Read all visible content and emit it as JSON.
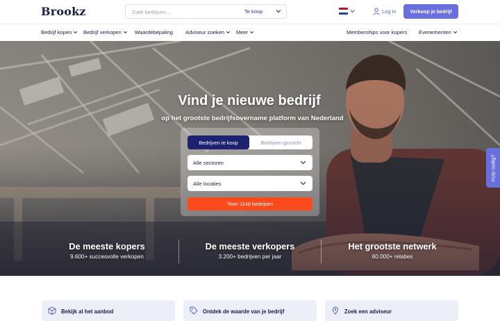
{
  "header": {
    "logo": "Brookz",
    "search_placeholder": "Zoek bedrijven...",
    "search_type": "Te koop",
    "login_label": "Log in",
    "sell_button": "Verkoop je bedrijf",
    "language_flag": "nl-flag-icon"
  },
  "nav": {
    "items": [
      {
        "label": "Bedrijf kopen",
        "dropdown": true
      },
      {
        "label": "Bedrijf verkopen",
        "dropdown": true
      },
      {
        "label": "Waardebepaling",
        "dropdown": false
      },
      {
        "label": "Adviseur zoeken",
        "dropdown": true
      },
      {
        "label": "Meer",
        "dropdown": true
      },
      {
        "label": "Memberships voor kopers",
        "dropdown": false
      },
      {
        "label": "Evenementen",
        "dropdown": true
      }
    ]
  },
  "hero": {
    "title": "Vind je nieuwe bedrijf",
    "subtitle": "op het grootste bedrijfsovername platform van Nederland",
    "tab_active": "Bedrijven te koop",
    "tab_inactive": "Bedrijven gezocht",
    "sector_select": "Alle sectoren",
    "location_select": "Alle locaties",
    "cta": "Toon 1148 bedrijven"
  },
  "stats": [
    {
      "title": "De meeste kopers",
      "sub": "9.600+ succesvolle verkopen"
    },
    {
      "title": "De meeste verkopers",
      "sub": "3.200+ bedrijven per jaar"
    },
    {
      "title": "Het grootste netwerk",
      "sub": "60.000+ relaties"
    }
  ],
  "help_tab": "Hulp nodig?",
  "cards": [
    {
      "label": "Bekijk al het aanbod",
      "icon": "box-icon"
    },
    {
      "label": "Ontdek de waarde van je bedrijf",
      "icon": "tag-icon"
    },
    {
      "label": "Zoek een adviseur",
      "icon": "location-pin-icon"
    }
  ],
  "colors": {
    "brand_navy": "#1d2270",
    "accent_purple": "#6a6fe0",
    "cta_orange": "#fb4a1c",
    "card_bg": "#edeff8",
    "text_dark": "#1b1f4a"
  }
}
